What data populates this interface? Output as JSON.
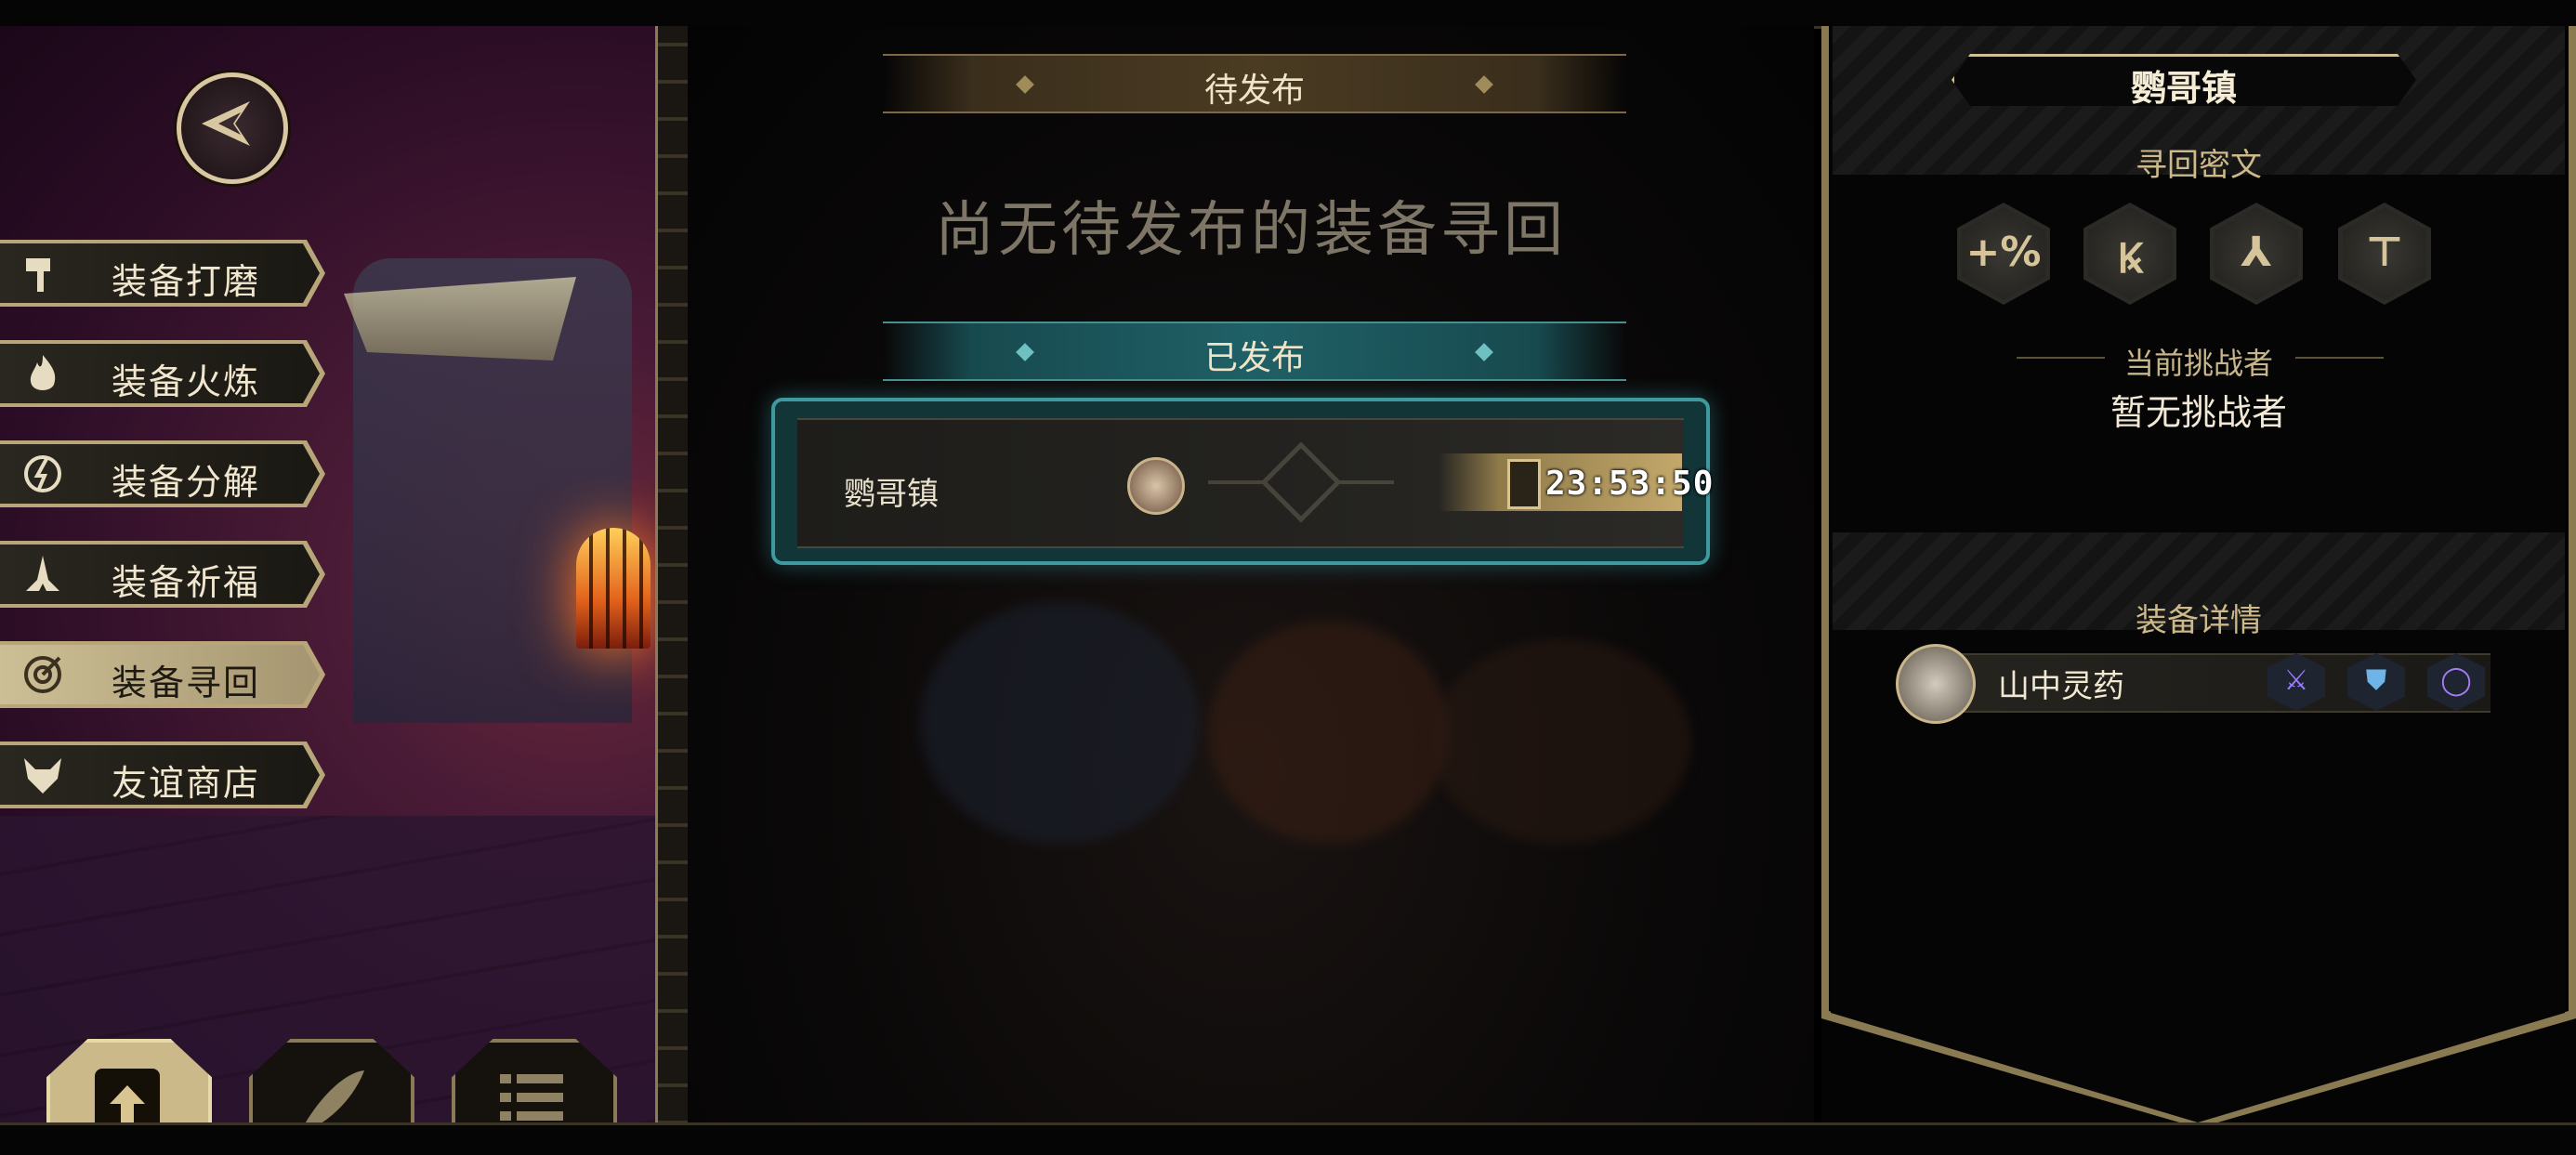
{
  "left_menu": {
    "items": [
      {
        "label": "装备打磨",
        "icon": "hammer-icon"
      },
      {
        "label": "装备火炼",
        "icon": "flame-icon"
      },
      {
        "label": "装备分解",
        "icon": "shatter-icon"
      },
      {
        "label": "装备祈福",
        "icon": "praying-hands-icon"
      },
      {
        "label": "装备寻回",
        "icon": "target-icon",
        "active": true
      },
      {
        "label": "友谊商店",
        "icon": "fox-icon"
      }
    ],
    "bottom_buttons": [
      "upload-file-icon",
      "feather-icon",
      "list-icon"
    ]
  },
  "center": {
    "pending_header": "待发布",
    "pending_empty": "尚无待发布的装备寻回",
    "published_header": "已发布",
    "published_item": {
      "town": "鹦哥镇",
      "timer": "23:53:50"
    }
  },
  "right": {
    "town_title": "鹦哥镇",
    "secret_text_header": "寻回密文",
    "runes": [
      "+%",
      "Ꝃ",
      "⅄",
      "⊤"
    ],
    "challenger_header": "当前挑战者",
    "challenger_value": "暂无挑战者",
    "equip_header": "装备详情",
    "equip_name": "山中灵药",
    "equip_slots": [
      "sword-icon",
      "armor-icon",
      "ring-icon"
    ]
  },
  "colors": {
    "gold": "#d2c095",
    "teal": "#3f9aa0",
    "left_bg": "#4a1b36"
  }
}
